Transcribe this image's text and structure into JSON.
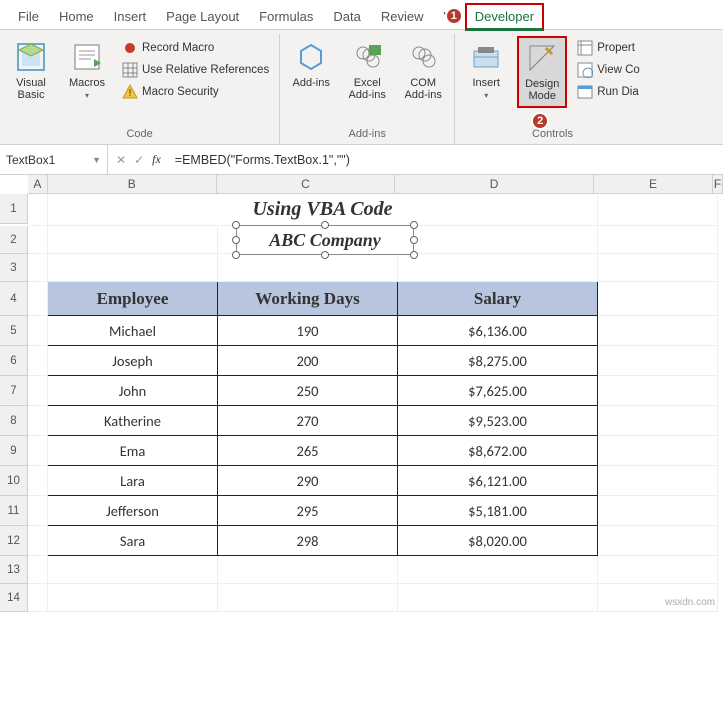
{
  "tabs": [
    "File",
    "Home",
    "Insert",
    "Page Layout",
    "Formulas",
    "Data",
    "Review",
    "Vi",
    "Developer"
  ],
  "annotations": {
    "a1": "1",
    "a2": "2"
  },
  "ribbon": {
    "code": {
      "visual_basic": "Visual Basic",
      "macros": "Macros",
      "record_macro": "Record Macro",
      "use_relative": "Use Relative References",
      "macro_security": "Macro Security",
      "label": "Code"
    },
    "addins": {
      "addins": "Add-ins",
      "excel_addins": "Excel Add-ins",
      "com_addins": "COM Add-ins",
      "label": "Add-ins"
    },
    "controls": {
      "insert": "Insert",
      "design_mode": "Design Mode",
      "properties": "Propert",
      "view_code": "View Co",
      "run_dialog": "Run Dia",
      "label": "Controls"
    }
  },
  "name_box": "TextBox1",
  "formula": "=EMBED(\"Forms.TextBox.1\",\"\")",
  "columns": [
    "A",
    "B",
    "C",
    "D",
    "E",
    "F"
  ],
  "rows": [
    "1",
    "2",
    "3",
    "4",
    "5",
    "6",
    "7",
    "8",
    "9",
    "10",
    "11",
    "12",
    "13",
    "14"
  ],
  "title": "Using VBA Code",
  "textbox_value": "ABC Company",
  "headers": {
    "employee": "Employee",
    "days": "Working Days",
    "salary": "Salary"
  },
  "chart_data": {
    "type": "table",
    "columns": [
      "Employee",
      "Working Days",
      "Salary"
    ],
    "rows": [
      {
        "employee": "Michael",
        "days": "190",
        "salary": "$6,136.00"
      },
      {
        "employee": "Joseph",
        "days": "200",
        "salary": "$8,275.00"
      },
      {
        "employee": "John",
        "days": "250",
        "salary": "$7,625.00"
      },
      {
        "employee": "Katherine",
        "days": "270",
        "salary": "$9,523.00"
      },
      {
        "employee": "Ema",
        "days": "265",
        "salary": "$8,672.00"
      },
      {
        "employee": "Lara",
        "days": "290",
        "salary": "$6,121.00"
      },
      {
        "employee": "Jefferson",
        "days": "295",
        "salary": "$5,181.00"
      },
      {
        "employee": "Sara",
        "days": "298",
        "salary": "$8,020.00"
      }
    ]
  },
  "watermark": "wsxdn.com"
}
